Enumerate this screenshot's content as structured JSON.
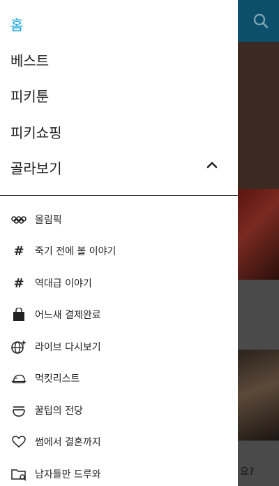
{
  "nav": {
    "items": [
      {
        "label": "홈",
        "active": true
      },
      {
        "label": "베스트"
      },
      {
        "label": "피키툰"
      },
      {
        "label": "피키쇼핑"
      },
      {
        "label": "골라보기"
      }
    ]
  },
  "submenu": [
    {
      "icon": "olympic-rings-icon",
      "label": "올림픽"
    },
    {
      "icon": "hashtag-icon",
      "label": "죽기 전에 볼 이야기"
    },
    {
      "icon": "hashtag-icon",
      "label": "역대급 이야기"
    },
    {
      "icon": "shopping-bag-icon",
      "label": "어느새 결제완료"
    },
    {
      "icon": "globe-sparkle-icon",
      "label": "라이브 다시보기"
    },
    {
      "icon": "food-tray-icon",
      "label": "먹킷리스트"
    },
    {
      "icon": "bowl-icon",
      "label": "꿀팁의 전당"
    },
    {
      "icon": "heart-icon",
      "label": "썸에서 결혼까지"
    },
    {
      "icon": "folder-icon",
      "label": "남자들만 드루와"
    }
  ],
  "background": {
    "partial_text": "요?"
  },
  "colors": {
    "accent": "#0aa0d8",
    "header": "#0b4f6a"
  }
}
